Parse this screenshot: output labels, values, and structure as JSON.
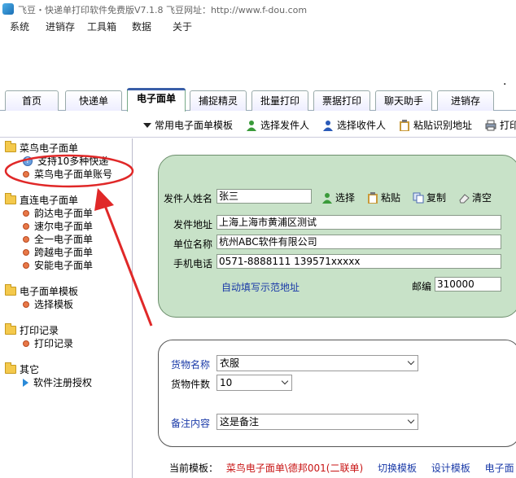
{
  "window": {
    "title": "飞豆・快递单打印软件免费版V7.1.8   飞豆网址：http://www.f-dou.com"
  },
  "menu": [
    "系统",
    "进销存",
    "工具箱",
    "数据",
    "关于"
  ],
  "tabs": [
    "首页",
    "快递单",
    "电子面单",
    "捕捉精灵",
    "批量打印",
    "票据打印",
    "聊天助手",
    "进销存"
  ],
  "active_tab": "电子面单",
  "toolbar": {
    "template_label": "常用电子面单模板",
    "select_sender": "选择发件人",
    "select_receiver": "选择收件人",
    "paste_address": "粘贴识别地址",
    "print_label": "打印"
  },
  "sidebar": {
    "g1": {
      "label": "菜鸟电子面单",
      "items": [
        "支持10多种快递",
        "菜鸟电子面单账号"
      ]
    },
    "g2": {
      "label": "直连电子面单",
      "items": [
        "韵达电子面单",
        "速尔电子面单",
        "全一电子面单",
        "跨越电子面单",
        "安能电子面单"
      ]
    },
    "g3": {
      "label": "电子面单模板",
      "items": [
        "选择模板"
      ]
    },
    "g4": {
      "label": "打印记录",
      "items": [
        "打印记录"
      ]
    },
    "g5": {
      "label": "其它",
      "items": [
        "软件注册授权"
      ]
    }
  },
  "sender": {
    "name_label": "发件人姓名",
    "name_value": "张三",
    "select": "选择",
    "paste": "粘贴",
    "copy": "复制",
    "clear": "清空",
    "address_label": "发件地址",
    "address_value": "上海上海市黄浦区测试",
    "company_label": "单位名称",
    "company_value": "杭州ABC软件有限公司",
    "phone_label": "手机电话",
    "phone_value": "0571-8888111 139571xxxxx",
    "autofill": "自动填写示范地址",
    "zip_label": "邮编",
    "zip_value": "310000"
  },
  "goods": {
    "name_label": "货物名称",
    "name_value": "衣服",
    "count_label": "货物件数",
    "count_value": "10",
    "note_label": "备注内容",
    "note_value": "这是备注"
  },
  "footer": {
    "current_label": "当前模板：",
    "current_value": "菜鸟电子面单\\德邦001(二联单)",
    "switch": "切换模板",
    "design": "设计模板",
    "more": "电子面"
  },
  "colors": {
    "panel_green": "#c8e2c8",
    "annotation_red": "#e02828",
    "link_blue": "#1a3aa8"
  }
}
